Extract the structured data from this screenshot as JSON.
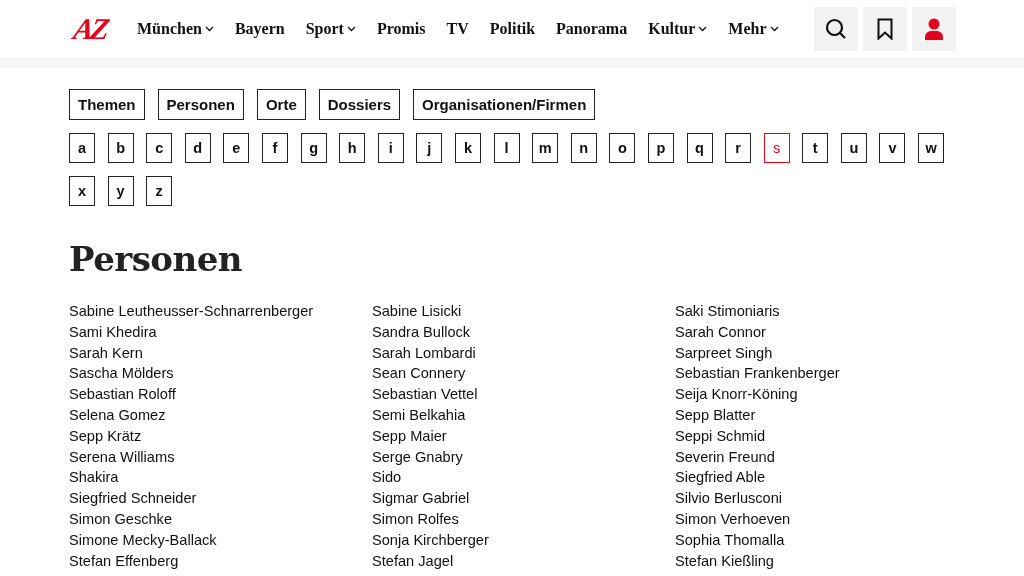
{
  "header": {
    "logo": "AZ",
    "nav": [
      {
        "label": "München",
        "dropdown": true
      },
      {
        "label": "Bayern",
        "dropdown": false
      },
      {
        "label": "Sport",
        "dropdown": true
      },
      {
        "label": "Promis",
        "dropdown": false
      },
      {
        "label": "TV",
        "dropdown": false
      },
      {
        "label": "Politik",
        "dropdown": false
      },
      {
        "label": "Panorama",
        "dropdown": false
      },
      {
        "label": "Kultur",
        "dropdown": true
      },
      {
        "label": "Mehr",
        "dropdown": true
      }
    ]
  },
  "categories": [
    {
      "label": "Themen",
      "selected": false
    },
    {
      "label": "Personen",
      "selected": false
    },
    {
      "label": "Orte",
      "selected": false
    },
    {
      "label": "Dossiers",
      "selected": false
    },
    {
      "label": "Organisationen/Firmen",
      "selected": false
    }
  ],
  "letters": [
    {
      "label": "a",
      "selected": false
    },
    {
      "label": "b",
      "selected": false
    },
    {
      "label": "c",
      "selected": false
    },
    {
      "label": "d",
      "selected": false
    },
    {
      "label": "e",
      "selected": false
    },
    {
      "label": "f",
      "selected": false
    },
    {
      "label": "g",
      "selected": false
    },
    {
      "label": "h",
      "selected": false
    },
    {
      "label": "i",
      "selected": false
    },
    {
      "label": "j",
      "selected": false
    },
    {
      "label": "k",
      "selected": false
    },
    {
      "label": "l",
      "selected": false
    },
    {
      "label": "m",
      "selected": false
    },
    {
      "label": "n",
      "selected": false
    },
    {
      "label": "o",
      "selected": false
    },
    {
      "label": "p",
      "selected": false
    },
    {
      "label": "q",
      "selected": false
    },
    {
      "label": "r",
      "selected": false
    },
    {
      "label": "s",
      "selected": true
    },
    {
      "label": "t",
      "selected": false
    },
    {
      "label": "u",
      "selected": false
    },
    {
      "label": "v",
      "selected": false
    },
    {
      "label": "w",
      "selected": false
    },
    {
      "label": "x",
      "selected": false
    },
    {
      "label": "y",
      "selected": false
    },
    {
      "label": "z",
      "selected": false
    }
  ],
  "heading": "Personen",
  "columns": [
    [
      "Sabine Leutheusser-Schnarrenberger",
      "Sami Khedira",
      "Sarah Kern",
      "Sascha Mölders",
      "Sebastian Roloff",
      "Selena Gomez",
      "Sepp Krätz",
      "Serena Williams",
      "Shakira",
      "Siegfried Schneider",
      "Simon Geschke",
      "Simone Mecky-Ballack",
      "Stefan Effenberg"
    ],
    [
      "Sabine Lisicki",
      "Sandra Bullock",
      "Sarah Lombardi",
      "Sean Connery",
      "Sebastian Vettel",
      "Semi Belkahia",
      "Sepp Maier",
      "Serge Gnabry",
      "Sido",
      "Sigmar Gabriel",
      "Simon Rolfes",
      "Sonja Kirchberger",
      "Stefan Jagel"
    ],
    [
      "Saki Stimoniaris",
      "Sarah Connor",
      "Sarpreet Singh",
      "Sebastian Frankenberger",
      "Seija Knorr-Köning",
      "Sepp Blatter",
      "Seppi Schmid",
      "Severin Freund",
      "Siegfried Able",
      "Silvio Berlusconi",
      "Simon Verhoeven",
      "Sophia Thomalla",
      "Stefan Kießling"
    ]
  ]
}
